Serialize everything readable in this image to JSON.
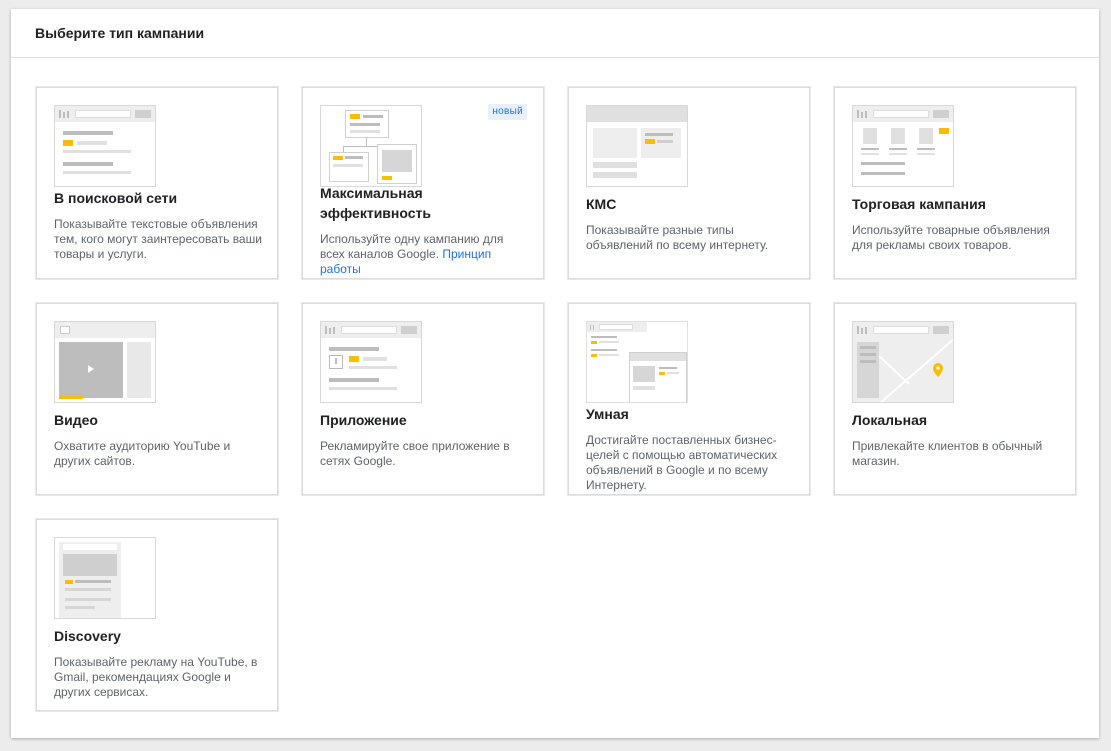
{
  "header": {
    "title": "Выберите тип кампании"
  },
  "cards": [
    {
      "title": "В поисковой сети",
      "desc": "Показывайте текстовые объявления тем, кого могут заинтересовать ваши товары и услуги."
    },
    {
      "title": "Максимальная эффективность",
      "desc": "Используйте одну кампанию для всех каналов Google.",
      "link": "Принцип работы",
      "badge": "новый"
    },
    {
      "title": "КМС",
      "desc": "Показывайте разные типы объявлений по всему интернету."
    },
    {
      "title": "Торговая кампания",
      "desc": "Используйте товарные объявления для рекламы своих товаров."
    },
    {
      "title": "Видео",
      "desc": "Охватите аудиторию YouTube и других сайтов."
    },
    {
      "title": "Приложение",
      "desc": "Рекламируйте свое приложение в сетях Google."
    },
    {
      "title": "Умная",
      "desc": "Достигайте поставленных бизнес-целей с помощью автоматических объявлений в Google и по всему Интернету."
    },
    {
      "title": "Локальная",
      "desc": "Привлекайте клиентов в обычный магазин."
    },
    {
      "title": "Discovery",
      "desc": "Показывайте рекламу на YouTube, в Gmail, рекомендациях Google и других сервисах."
    }
  ],
  "colors": {
    "accent": "#fbbc04",
    "link": "#1a73e8",
    "badge_bg": "#e8f0fe"
  }
}
